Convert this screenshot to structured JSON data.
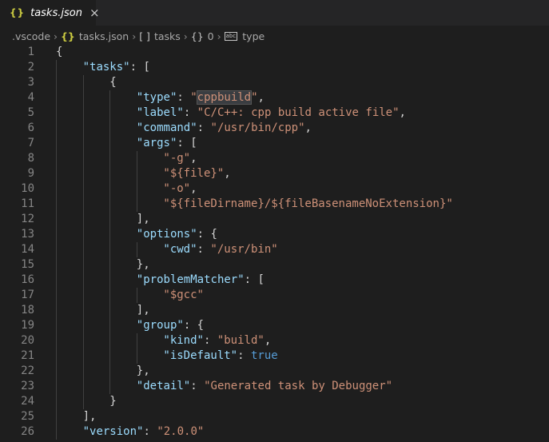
{
  "tab": {
    "braces": "{}",
    "filename": "tasks.json",
    "close": "×"
  },
  "breadcrumb": {
    "folder": ".vscode",
    "file_icon": "{}",
    "file": "tasks.json",
    "array_icon": "[ ]",
    "array": "tasks",
    "object_icon": "{}",
    "object": "0",
    "string_icon": "abc",
    "property": "type"
  },
  "editor": {
    "lines": [
      {
        "n": "1",
        "indent": 0,
        "t": [
          [
            "p",
            "{"
          ]
        ]
      },
      {
        "n": "2",
        "indent": 1,
        "t": [
          [
            "k",
            "\"tasks\""
          ],
          [
            "p",
            ": ["
          ]
        ]
      },
      {
        "n": "3",
        "indent": 2,
        "t": [
          [
            "p",
            "{"
          ]
        ]
      },
      {
        "n": "4",
        "indent": 3,
        "t": [
          [
            "k",
            "\"type\""
          ],
          [
            "p",
            ": "
          ],
          [
            "s",
            "\""
          ],
          [
            "sh",
            "cppbuild"
          ],
          [
            "s",
            "\""
          ],
          [
            "p",
            ","
          ]
        ]
      },
      {
        "n": "5",
        "indent": 3,
        "t": [
          [
            "k",
            "\"label\""
          ],
          [
            "p",
            ": "
          ],
          [
            "s",
            "\"C/C++: cpp build active file\""
          ],
          [
            "p",
            ","
          ]
        ]
      },
      {
        "n": "6",
        "indent": 3,
        "t": [
          [
            "k",
            "\"command\""
          ],
          [
            "p",
            ": "
          ],
          [
            "s",
            "\"/usr/bin/cpp\""
          ],
          [
            "p",
            ","
          ]
        ]
      },
      {
        "n": "7",
        "indent": 3,
        "t": [
          [
            "k",
            "\"args\""
          ],
          [
            "p",
            ": ["
          ]
        ]
      },
      {
        "n": "8",
        "indent": 4,
        "t": [
          [
            "s",
            "\"-g\""
          ],
          [
            "p",
            ","
          ]
        ]
      },
      {
        "n": "9",
        "indent": 4,
        "t": [
          [
            "s",
            "\"${file}\""
          ],
          [
            "p",
            ","
          ]
        ]
      },
      {
        "n": "10",
        "indent": 4,
        "t": [
          [
            "s",
            "\"-o\""
          ],
          [
            "p",
            ","
          ]
        ]
      },
      {
        "n": "11",
        "indent": 4,
        "t": [
          [
            "s",
            "\"${fileDirname}/${fileBasenameNoExtension}\""
          ]
        ]
      },
      {
        "n": "12",
        "indent": 3,
        "t": [
          [
            "p",
            "],"
          ]
        ]
      },
      {
        "n": "13",
        "indent": 3,
        "t": [
          [
            "k",
            "\"options\""
          ],
          [
            "p",
            ": {"
          ]
        ]
      },
      {
        "n": "14",
        "indent": 4,
        "t": [
          [
            "k",
            "\"cwd\""
          ],
          [
            "p",
            ": "
          ],
          [
            "s",
            "\"/usr/bin\""
          ]
        ]
      },
      {
        "n": "15",
        "indent": 3,
        "t": [
          [
            "p",
            "},"
          ]
        ]
      },
      {
        "n": "16",
        "indent": 3,
        "t": [
          [
            "k",
            "\"problemMatcher\""
          ],
          [
            "p",
            ": ["
          ]
        ]
      },
      {
        "n": "17",
        "indent": 4,
        "t": [
          [
            "s",
            "\"$gcc\""
          ]
        ]
      },
      {
        "n": "18",
        "indent": 3,
        "t": [
          [
            "p",
            "],"
          ]
        ]
      },
      {
        "n": "19",
        "indent": 3,
        "t": [
          [
            "k",
            "\"group\""
          ],
          [
            "p",
            ": {"
          ]
        ]
      },
      {
        "n": "20",
        "indent": 4,
        "t": [
          [
            "k",
            "\"kind\""
          ],
          [
            "p",
            ": "
          ],
          [
            "s",
            "\"build\""
          ],
          [
            "p",
            ","
          ]
        ]
      },
      {
        "n": "21",
        "indent": 4,
        "t": [
          [
            "k",
            "\"isDefault\""
          ],
          [
            "p",
            ": "
          ],
          [
            "b",
            "true"
          ]
        ]
      },
      {
        "n": "22",
        "indent": 3,
        "t": [
          [
            "p",
            "},"
          ]
        ]
      },
      {
        "n": "23",
        "indent": 3,
        "t": [
          [
            "k",
            "\"detail\""
          ],
          [
            "p",
            ": "
          ],
          [
            "s",
            "\"Generated task by Debugger\""
          ]
        ]
      },
      {
        "n": "24",
        "indent": 2,
        "t": [
          [
            "p",
            "}"
          ]
        ]
      },
      {
        "n": "25",
        "indent": 1,
        "t": [
          [
            "p",
            "],"
          ]
        ]
      },
      {
        "n": "26",
        "indent": 1,
        "t": [
          [
            "k",
            "\"version\""
          ],
          [
            "p",
            ": "
          ],
          [
            "s",
            "\"2.0.0\""
          ]
        ]
      }
    ]
  }
}
